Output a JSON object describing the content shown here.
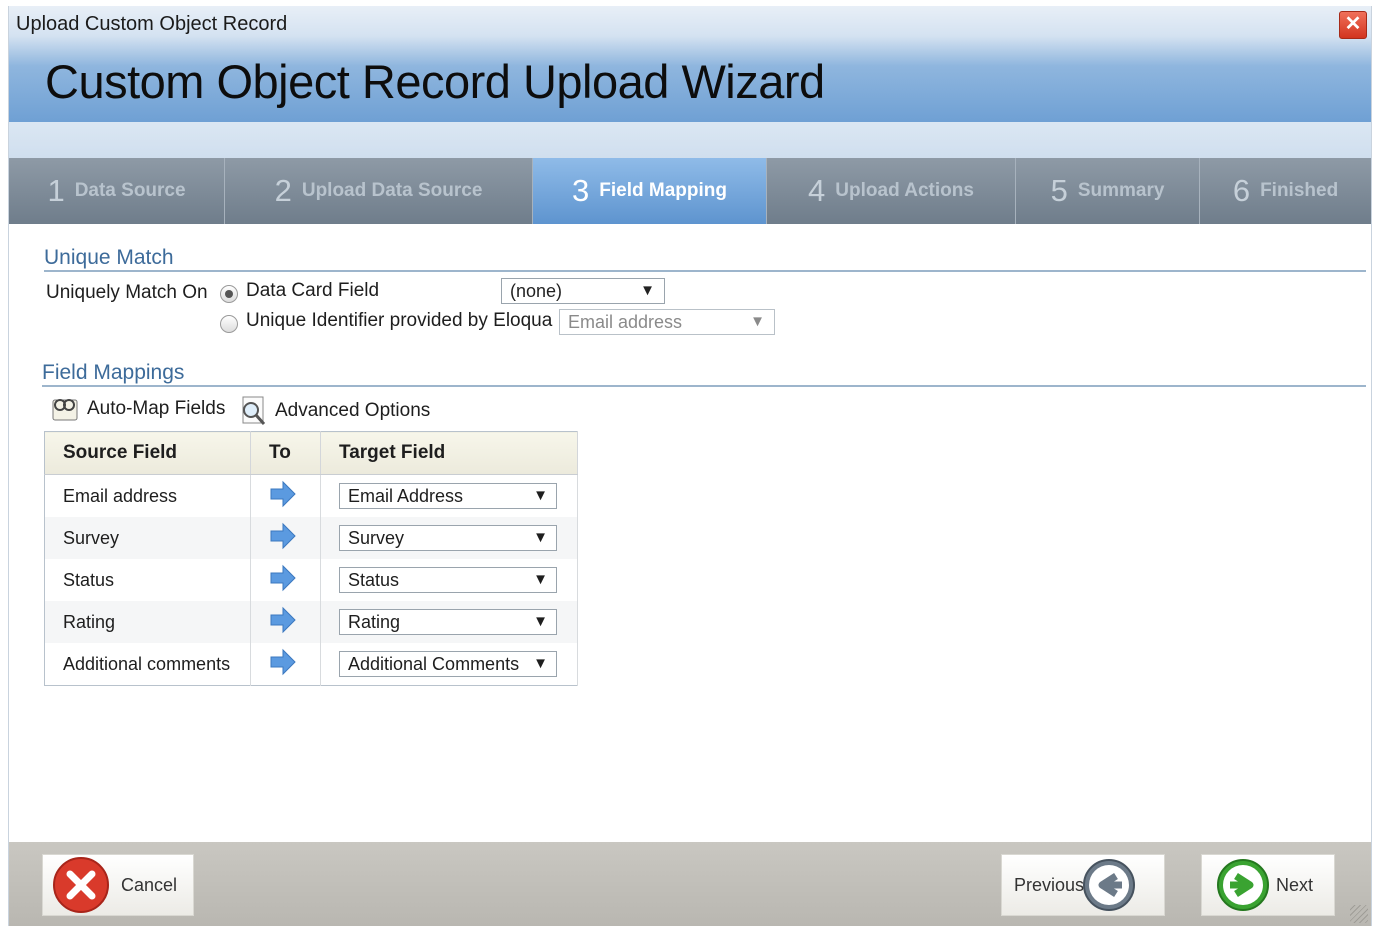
{
  "window": {
    "title": "Upload Custom Object Record",
    "close_icon": "close-icon",
    "heading": "Custom Object Record Upload Wizard"
  },
  "steps": [
    {
      "num": "1",
      "label": "Data Source",
      "active": false
    },
    {
      "num": "2",
      "label": "Upload Data Source",
      "active": false
    },
    {
      "num": "3",
      "label": "Field Mapping",
      "active": true
    },
    {
      "num": "4",
      "label": "Upload Actions",
      "active": false
    },
    {
      "num": "5",
      "label": "Summary",
      "active": false
    },
    {
      "num": "6",
      "label": "Finished",
      "active": false
    }
  ],
  "unique_match": {
    "section_title": "Unique Match",
    "label": "Uniquely Match On",
    "option1_label": "Data Card Field",
    "option1_selected": true,
    "option1_value": "(none)",
    "option2_label": "Unique Identifier provided by Eloqua",
    "option2_selected": false,
    "option2_value": "Email address"
  },
  "field_mappings": {
    "section_title": "Field Mappings",
    "automap_label": "Auto-Map Fields",
    "advanced_label": "Advanced Options",
    "columns": [
      "Source Field",
      "To",
      "Target Field"
    ],
    "rows": [
      {
        "source": "Email address",
        "target": "Email Address"
      },
      {
        "source": "Survey",
        "target": "Survey"
      },
      {
        "source": "Status",
        "target": "Status"
      },
      {
        "source": "Rating",
        "target": "Rating"
      },
      {
        "source": "Additional comments",
        "target": "Additional Comments"
      }
    ]
  },
  "footer": {
    "cancel_label": "Cancel",
    "previous_label": "Previous",
    "next_label": "Next"
  },
  "colors": {
    "accent": "#5e94cf",
    "section_title": "#3d6b9a",
    "arrow": "#4f8fd6",
    "cancel": "#d93a2b",
    "next": "#3aa331"
  }
}
